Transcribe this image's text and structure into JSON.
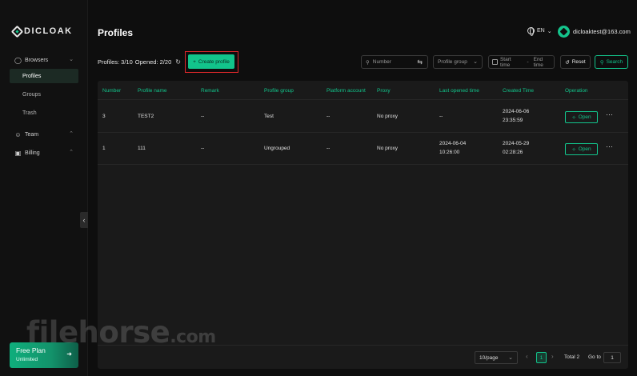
{
  "brand": {
    "name": "DICLOAK"
  },
  "sidebar": {
    "browsers": "Browsers",
    "profiles": "Profiles",
    "groups": "Groups",
    "trash": "Trash",
    "team": "Team",
    "billing": "Billing"
  },
  "plan": {
    "name": "Free Plan",
    "sub": "Unlimited"
  },
  "header": {
    "title": "Profiles",
    "lang": "EN",
    "email": "dicloaktest@163.com"
  },
  "toolbar": {
    "profiles_count": "Profiles: 3/10",
    "opened_count": "Opened: 2/20",
    "create_label": "Create profile",
    "search_placeholder": "Number",
    "group_placeholder": "Profile group",
    "start_time": "Start time",
    "range_sep": "-",
    "end_time": "End time",
    "reset_label": "Reset",
    "search_label": "Search"
  },
  "table": {
    "headers": [
      "Number",
      "Profile name",
      "Remark",
      "Profile group",
      "Platform account",
      "Proxy",
      "Last opened time",
      "Created Time",
      "Operation"
    ],
    "rows": [
      {
        "number": "3",
        "name": "TEST2",
        "remark": "--",
        "group": "Test",
        "platform": "--",
        "proxy": "No proxy",
        "last_opened": "--",
        "last_opened_time": "",
        "created_date": "2024-06-06",
        "created_time": "23:35:59",
        "open": "Open"
      },
      {
        "number": "1",
        "name": "111",
        "remark": "--",
        "group": "Ungrouped",
        "platform": "--",
        "proxy": "No proxy",
        "last_opened": "2024-06-04",
        "last_opened_time": "10:26:00",
        "created_date": "2024-05-29",
        "created_time": "02:28:26",
        "open": "Open"
      }
    ]
  },
  "pagination": {
    "page_size": "10/page",
    "current": "1",
    "total": "Total 2",
    "goto": "Go to",
    "goto_value": "1"
  },
  "watermark": {
    "main": "filehorse",
    "suffix": ".com"
  },
  "colors": {
    "accent": "#12c48b",
    "highlight": "#e0282b",
    "background": "#0e0e0e"
  }
}
